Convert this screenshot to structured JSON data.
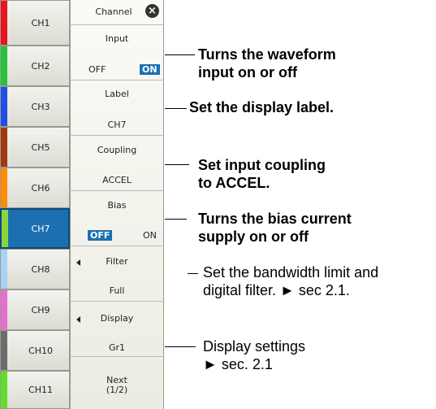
{
  "channels": [
    {
      "label": "CH1",
      "color": "#e8141e"
    },
    {
      "label": "CH2",
      "color": "#27c43b"
    },
    {
      "label": "CH3",
      "color": "#1f4fe6"
    },
    {
      "label": "CH5",
      "color": "#a0390f"
    },
    {
      "label": "CH6",
      "color": "#ff8c00"
    },
    {
      "label": "CH7",
      "color": "#8ad53c",
      "selected": true
    },
    {
      "label": "CH8",
      "color": "#a6d3f6"
    },
    {
      "label": "CH9",
      "color": "#e46fcf"
    },
    {
      "label": "CH10",
      "color": "#6c6c6c"
    },
    {
      "label": "CH11",
      "color": "#5ee02a"
    }
  ],
  "menu": {
    "title": "Channel",
    "close_icon": "close-icon",
    "input": {
      "label": "Input",
      "off": "OFF",
      "on": "ON",
      "state": "ON"
    },
    "label": {
      "label": "Label",
      "value": "CH7"
    },
    "coupling": {
      "label": "Coupling",
      "value": "ACCEL"
    },
    "bias": {
      "label": "Bias",
      "off": "OFF",
      "on": "ON",
      "state": "OFF"
    },
    "filter": {
      "label": "Filter",
      "value": "Full"
    },
    "display": {
      "label": "Display",
      "value": "Gr1"
    },
    "next": {
      "line1": "Next",
      "line2": "(1/2)"
    }
  },
  "annotations": {
    "input_1": "Turns the waveform",
    "input_2": "input on or off",
    "label_1": "Set the display label.",
    "coupling_1": "Set input coupling",
    "coupling_2": "to ACCEL.",
    "bias_1": "Turns the bias current",
    "bias_2": "supply on or off",
    "filter_1": "Set the bandwidth limit and",
    "filter_2": "digital filter. ► sec 2.1.",
    "display_1": "Display settings",
    "display_2": "► sec. 2.1"
  }
}
